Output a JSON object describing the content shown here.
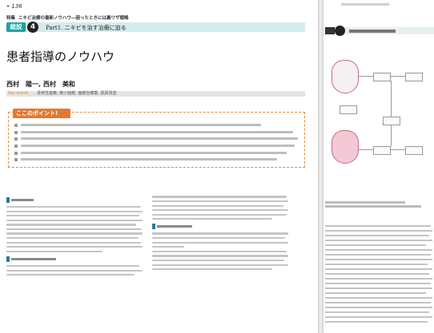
{
  "page": {
    "number": "136",
    "series_tag": "特集",
    "series_title": "ニキビ治療の最新ノウハウ―困ったときには裏ワザ戦略",
    "section_badge": "総説",
    "section_number": "4",
    "part_title": "Part1. ニキビを治す治療に迫る",
    "title": "患者指導のノウハウ",
    "authors": "西村　陽一, 西村　美和",
    "keywords_label": "Key words",
    "keywords": "尋常性痤瘡, 微小面皰, 面皰治療薬, 肌質改善",
    "point_heading": "ここのポイント!"
  },
  "colors": {
    "accent_teal": "#1aa3a0",
    "accent_orange": "#e07a30"
  }
}
